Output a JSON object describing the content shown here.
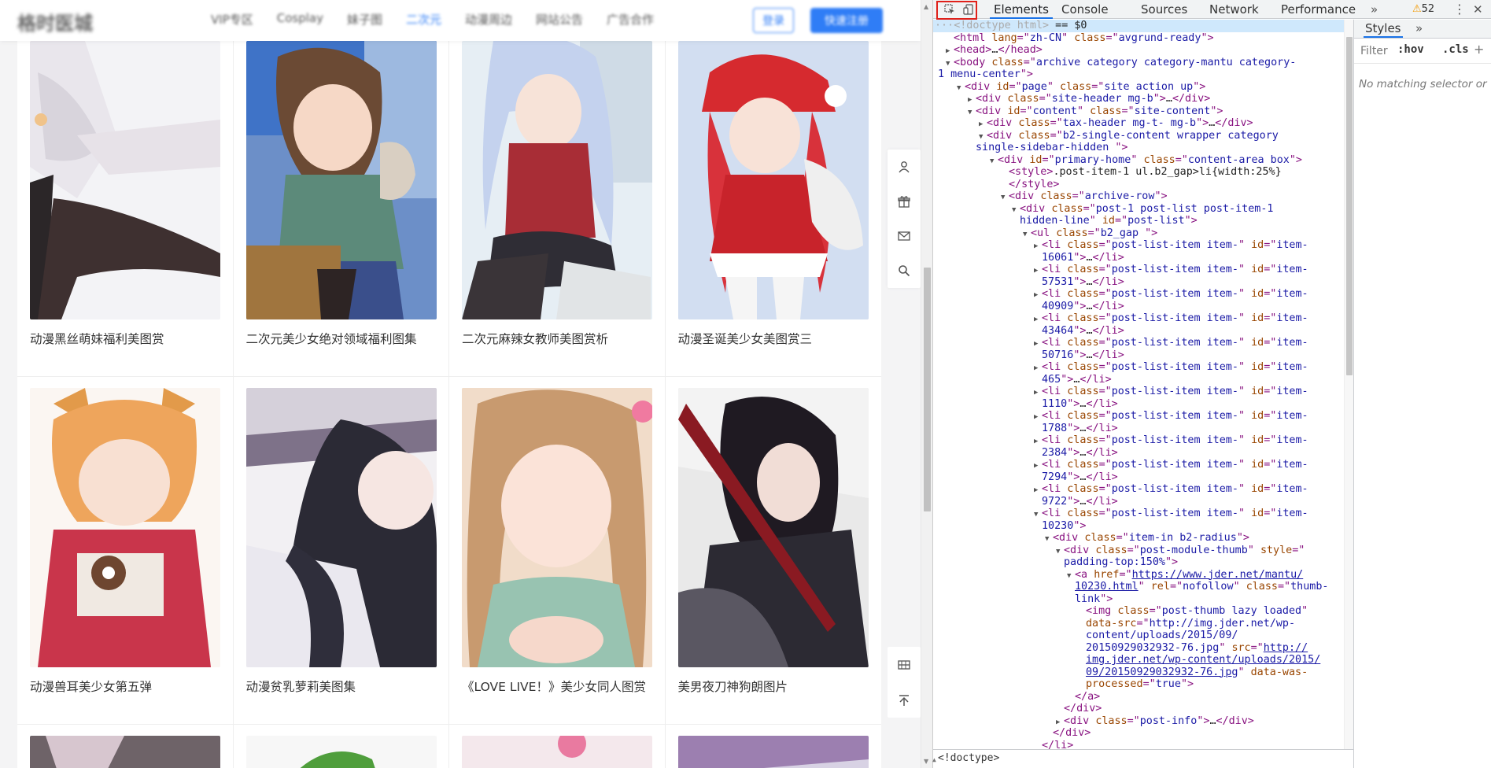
{
  "site": {
    "logo": "格时医城",
    "nav": [
      "VIP专区",
      "Cosplay",
      "妹子图",
      "二次元",
      "动漫周边",
      "网站公告",
      "广告合作"
    ],
    "nav_active_index": 3,
    "login_label": "登录",
    "register_label": "快速注册",
    "accent_color": "#2f7df6",
    "rows": [
      {
        "cards": [
          {
            "title": "动漫黑丝萌妹福利美图赏"
          },
          {
            "title": "二次元美少女绝对领域福利图集"
          },
          {
            "title": "二次元麻辣女教师美图赏析"
          },
          {
            "title": "动漫圣诞美少女美图赏三"
          }
        ]
      },
      {
        "cards": [
          {
            "title": "动漫兽耳美少女第五弹"
          },
          {
            "title": "动漫贫乳萝莉美图集"
          },
          {
            "title": "《LOVE LIVE！》美少女同人图赏"
          },
          {
            "title": "美男夜刀神狗朗图片"
          }
        ]
      }
    ],
    "float_icons": [
      "user-icon",
      "gift-icon",
      "mail-icon",
      "search-icon"
    ],
    "float_icons_bottom": [
      "qrcode-icon",
      "back-to-top-icon"
    ]
  },
  "devtools": {
    "tabs": [
      "Elements",
      "Console",
      "Sources",
      "Network",
      "Performance"
    ],
    "active_tab": "Elements",
    "overflow": "»",
    "warnings_count": "52",
    "styles_tab": "Styles",
    "filter_placeholder": "Filter",
    "hov_label": ":hov",
    "cls_label": ".cls",
    "no_match": "No matching selector or",
    "breadcrumb": "<!doctype>",
    "dom_lines": [
      {
        "indent": 0,
        "html": "<span class='cmt'>···</span><span class='cmt'>&lt;!doctype html&gt;</span><span class='txt'> == $0</span>",
        "sel": true
      },
      {
        "indent": 1,
        "html": "&lt;html <span class='attr'>lang</span>=\"<span class='val'>zh-CN</span>\" <span class='attr'>class</span>=\"<span class='val'>avgrund-ready</span>\"&gt;"
      },
      {
        "indent": 1,
        "tri": "▶",
        "html": "&lt;head&gt;<span class='txt'>…</span>&lt;/head&gt;"
      },
      {
        "indent": 1,
        "tri": "▼",
        "html": "&lt;body <span class='attr'>class</span>=\"<span class='val'>archive category category-mantu category-</span>"
      },
      {
        "indent": 0,
        "html": "<span class='val'>1 menu-center</span>\"&gt;"
      },
      {
        "indent": 2,
        "tri": "▼",
        "html": "&lt;div <span class='attr'>id</span>=\"<span class='val'>page</span>\" <span class='attr'>class</span>=\"<span class='val'>site action up</span>\"&gt;"
      },
      {
        "indent": 3,
        "tri": "▶",
        "html": "&lt;div <span class='attr'>class</span>=\"<span class='val'>site-header mg-b</span>\"&gt;<span class='txt'>…</span>&lt;/div&gt;"
      },
      {
        "indent": 3,
        "tri": "▼",
        "html": "&lt;div <span class='attr'>id</span>=\"<span class='val'>content</span>\" <span class='attr'>class</span>=\"<span class='val'>site-content</span>\"&gt;"
      },
      {
        "indent": 4,
        "tri": "▶",
        "html": "&lt;div <span class='attr'>class</span>=\"<span class='val'>tax-header mg-t- mg-b</span>\"&gt;<span class='txt'>…</span>&lt;/div&gt;"
      },
      {
        "indent": 4,
        "tri": "▼",
        "html": "&lt;div <span class='attr'>class</span>=\"<span class='val'>b2-single-content wrapper category</span>"
      },
      {
        "indent": 3,
        "html": "<span class='val'>single-sidebar-hidden </span>\"&gt;"
      },
      {
        "indent": 5,
        "tri": "▼",
        "html": "&lt;div <span class='attr'>id</span>=\"<span class='val'>primary-home</span>\" <span class='attr'>class</span>=\"<span class='val'>content-area box</span>\"&gt;"
      },
      {
        "indent": 6,
        "html": "&lt;style&gt;<span class='txt'>.post-item-1 ul.b2_gap&gt;li{width:25%}</span>"
      },
      {
        "indent": 6,
        "html": "&lt;/style&gt;"
      },
      {
        "indent": 6,
        "tri": "▼",
        "html": "&lt;div <span class='attr'>class</span>=\"<span class='val'>archive-row</span>\"&gt;"
      },
      {
        "indent": 7,
        "tri": "▼",
        "html": "&lt;div <span class='attr'>class</span>=\"<span class='val'>post-1 post-list post-item-1</span>"
      },
      {
        "indent": 7,
        "html": "<span class='val'>hidden-line</span>\" <span class='attr'>id</span>=\"<span class='val'>post-list</span>\"&gt;"
      },
      {
        "indent": 8,
        "tri": "▼",
        "html": "&lt;ul <span class='attr'>class</span>=\"<span class='val'>b2_gap </span>\"&gt;"
      },
      {
        "indent": 9,
        "tri": "▶",
        "html": "&lt;li <span class='attr'>class</span>=\"<span class='val'>post-list-item item-</span>\" <span class='attr'>id</span>=\"<span class='val'>item-</span>"
      },
      {
        "indent": 9,
        "html": "<span class='val'>16061</span>\"&gt;<span class='txt'>…</span>&lt;/li&gt;"
      },
      {
        "indent": 9,
        "tri": "▶",
        "html": "&lt;li <span class='attr'>class</span>=\"<span class='val'>post-list-item item-</span>\" <span class='attr'>id</span>=\"<span class='val'>item-</span>"
      },
      {
        "indent": 9,
        "html": "<span class='val'>57531</span>\"&gt;<span class='txt'>…</span>&lt;/li&gt;"
      },
      {
        "indent": 9,
        "tri": "▶",
        "html": "&lt;li <span class='attr'>class</span>=\"<span class='val'>post-list-item item-</span>\" <span class='attr'>id</span>=\"<span class='val'>item-</span>"
      },
      {
        "indent": 9,
        "html": "<span class='val'>40909</span>\"&gt;<span class='txt'>…</span>&lt;/li&gt;"
      },
      {
        "indent": 9,
        "tri": "▶",
        "html": "&lt;li <span class='attr'>class</span>=\"<span class='val'>post-list-item item-</span>\" <span class='attr'>id</span>=\"<span class='val'>item-</span>"
      },
      {
        "indent": 9,
        "html": "<span class='val'>43464</span>\"&gt;<span class='txt'>…</span>&lt;/li&gt;"
      },
      {
        "indent": 9,
        "tri": "▶",
        "html": "&lt;li <span class='attr'>class</span>=\"<span class='val'>post-list-item item-</span>\" <span class='attr'>id</span>=\"<span class='val'>item-</span>"
      },
      {
        "indent": 9,
        "html": "<span class='val'>50716</span>\"&gt;<span class='txt'>…</span>&lt;/li&gt;"
      },
      {
        "indent": 9,
        "tri": "▶",
        "html": "&lt;li <span class='attr'>class</span>=\"<span class='val'>post-list-item item-</span>\" <span class='attr'>id</span>=\"<span class='val'>item-</span>"
      },
      {
        "indent": 9,
        "html": "<span class='val'>465</span>\"&gt;<span class='txt'>…</span>&lt;/li&gt;"
      },
      {
        "indent": 9,
        "tri": "▶",
        "html": "&lt;li <span class='attr'>class</span>=\"<span class='val'>post-list-item item-</span>\" <span class='attr'>id</span>=\"<span class='val'>item-</span>"
      },
      {
        "indent": 9,
        "html": "<span class='val'>1110</span>\"&gt;<span class='txt'>…</span>&lt;/li&gt;"
      },
      {
        "indent": 9,
        "tri": "▶",
        "html": "&lt;li <span class='attr'>class</span>=\"<span class='val'>post-list-item item-</span>\" <span class='attr'>id</span>=\"<span class='val'>item-</span>"
      },
      {
        "indent": 9,
        "html": "<span class='val'>1788</span>\"&gt;<span class='txt'>…</span>&lt;/li&gt;"
      },
      {
        "indent": 9,
        "tri": "▶",
        "html": "&lt;li <span class='attr'>class</span>=\"<span class='val'>post-list-item item-</span>\" <span class='attr'>id</span>=\"<span class='val'>item-</span>"
      },
      {
        "indent": 9,
        "html": "<span class='val'>2384</span>\"&gt;<span class='txt'>…</span>&lt;/li&gt;"
      },
      {
        "indent": 9,
        "tri": "▶",
        "html": "&lt;li <span class='attr'>class</span>=\"<span class='val'>post-list-item item-</span>\" <span class='attr'>id</span>=\"<span class='val'>item-</span>"
      },
      {
        "indent": 9,
        "html": "<span class='val'>7294</span>\"&gt;<span class='txt'>…</span>&lt;/li&gt;"
      },
      {
        "indent": 9,
        "tri": "▶",
        "html": "&lt;li <span class='attr'>class</span>=\"<span class='val'>post-list-item item-</span>\" <span class='attr'>id</span>=\"<span class='val'>item-</span>"
      },
      {
        "indent": 9,
        "html": "<span class='val'>9722</span>\"&gt;<span class='txt'>…</span>&lt;/li&gt;"
      },
      {
        "indent": 9,
        "tri": "▼",
        "html": "&lt;li <span class='attr'>class</span>=\"<span class='val'>post-list-item item-</span>\" <span class='attr'>id</span>=\"<span class='val'>item-</span>"
      },
      {
        "indent": 9,
        "html": "<span class='val'>10230</span>\"&gt;"
      },
      {
        "indent": 10,
        "tri": "▼",
        "html": "&lt;div <span class='attr'>class</span>=\"<span class='val'>item-in b2-radius</span>\"&gt;"
      },
      {
        "indent": 11,
        "tri": "▼",
        "html": "&lt;div <span class='attr'>class</span>=\"<span class='val'>post-module-thumb</span>\" <span class='attr'>style</span>=\""
      },
      {
        "indent": 11,
        "html": "<span class='val'>padding-top:150%</span>\"&gt;"
      },
      {
        "indent": 12,
        "tri": "▼",
        "html": "&lt;a <span class='attr'>href</span>=\"<span class='url'>https://www.jder.net/mantu/</span>"
      },
      {
        "indent": 12,
        "html": "<span class='url'>10230.html</span>\" <span class='attr'>rel</span>=\"<span class='val'>nofollow</span>\" <span class='attr'>class</span>=\"<span class='val'>thumb-</span>"
      },
      {
        "indent": 12,
        "html": "<span class='val'>link</span>\"&gt;"
      },
      {
        "indent": 13,
        "html": "&lt;img <span class='attr'>class</span>=\"<span class='val'>post-thumb lazy loaded</span>\""
      },
      {
        "indent": 13,
        "html": "<span class='attr'>data-src</span>=\"<span class='val'>http://img.jder.net/wp-</span>"
      },
      {
        "indent": 13,
        "html": "<span class='val'>content/uploads/2015/09/</span>"
      },
      {
        "indent": 13,
        "html": "<span class='val'>20150929032932-76.jpg</span>\" <span class='attr'>src</span>=\"<span class='url'>http://</span>"
      },
      {
        "indent": 13,
        "html": "<span class='url'>img.jder.net/wp-content/uploads/2015/</span>"
      },
      {
        "indent": 13,
        "html": "<span class='url'>09/20150929032932-76.jpg</span>\" <span class='attr'>data-was-</span>"
      },
      {
        "indent": 13,
        "html": "<span class='attr'>processed</span>=\"<span class='val'>true</span>\"&gt;"
      },
      {
        "indent": 12,
        "html": "&lt;/a&gt;"
      },
      {
        "indent": 11,
        "html": "&lt;/div&gt;"
      },
      {
        "indent": 11,
        "tri": "▶",
        "html": "&lt;div <span class='attr'>class</span>=\"<span class='val'>post-info</span>\"&gt;<span class='txt'>…</span>&lt;/div&gt;"
      },
      {
        "indent": 10,
        "html": "&lt;/div&gt;"
      },
      {
        "indent": 9,
        "html": "&lt;/li&gt;"
      }
    ]
  }
}
